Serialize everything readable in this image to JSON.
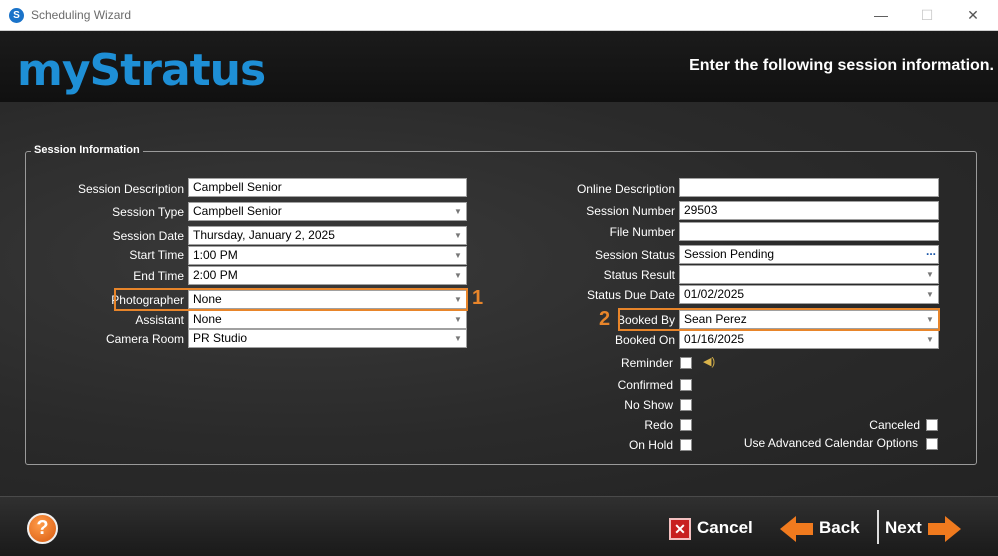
{
  "window": {
    "title": "Scheduling Wizard",
    "icon_glyph": "S",
    "minimize": "—",
    "maximize": "☐",
    "close": "✕"
  },
  "header": {
    "logo": "myStratus",
    "instruction": "Enter the following session information."
  },
  "group": {
    "legend": "Session Information"
  },
  "left": {
    "session_description": {
      "label": "Session Description",
      "value": "Campbell Senior"
    },
    "session_type": {
      "label": "Session Type",
      "value": "Campbell Senior"
    },
    "session_date": {
      "label": "Session Date",
      "value": "Thursday, January 2, 2025"
    },
    "start_time": {
      "label": "Start Time",
      "value": "1:00 PM"
    },
    "end_time": {
      "label": "End Time",
      "value": "2:00 PM"
    },
    "photographer": {
      "label": "Photographer",
      "value": "None"
    },
    "assistant": {
      "label": "Assistant",
      "value": "None"
    },
    "camera_room": {
      "label": "Camera Room",
      "value": "PR Studio"
    }
  },
  "right": {
    "online_description": {
      "label": "Online Description",
      "value": ""
    },
    "session_number": {
      "label": "Session Number",
      "value": "29503"
    },
    "file_number": {
      "label": "File Number",
      "value": ""
    },
    "session_status": {
      "label": "Session Status",
      "value": "Session Pending"
    },
    "status_result": {
      "label": "Status Result",
      "value": ""
    },
    "status_due_date": {
      "label": "Status Due Date",
      "value": "01/02/2025"
    },
    "booked_by": {
      "label": "Booked By",
      "value": "Sean Perez"
    },
    "booked_on": {
      "label": "Booked On",
      "value": "01/16/2025"
    }
  },
  "checks": {
    "reminder": "Reminder",
    "confirmed": "Confirmed",
    "no_show": "No Show",
    "redo": "Redo",
    "on_hold": "On Hold",
    "canceled": "Canceled",
    "advanced_calendar": "Use Advanced Calendar Options"
  },
  "annotations": {
    "one": "1",
    "two": "2",
    "color": "#e8852a"
  },
  "footer": {
    "help": "?",
    "cancel": "Cancel",
    "back": "Back",
    "next": "Next",
    "cancel_glyph": "✕"
  },
  "colors": {
    "accent": "#e8852a",
    "logo": "#1e8fd6",
    "button_arrow": "#f07a1e"
  },
  "icons": [
    "app-icon",
    "dropdown-arrow-icon",
    "ellipsis-icon",
    "speaker-icon",
    "help-icon",
    "cancel-x-icon",
    "back-arrow-icon",
    "next-arrow-icon"
  ]
}
